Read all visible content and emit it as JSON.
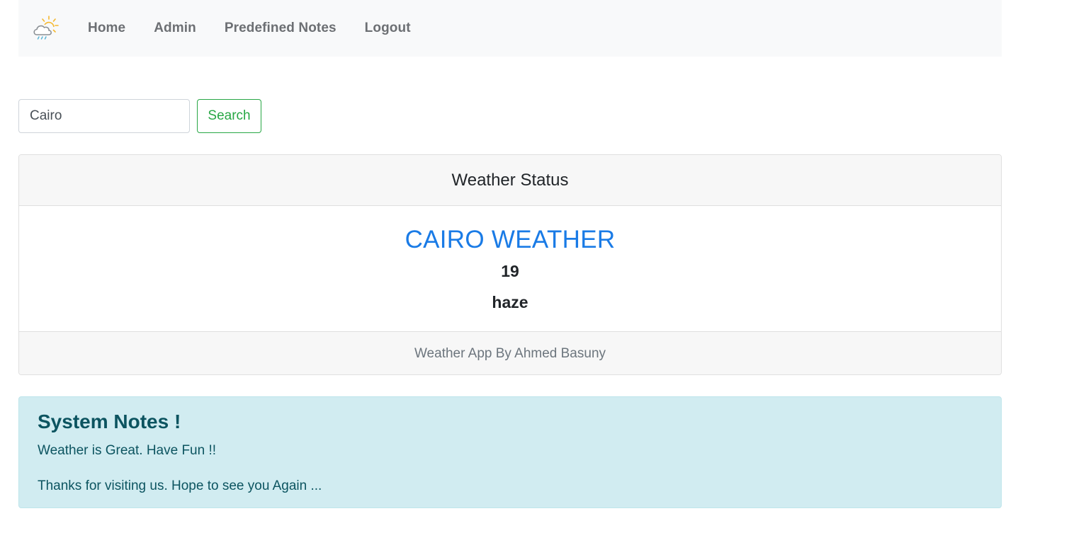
{
  "nav": {
    "brand_icon": "weather-logo-icon",
    "links": [
      {
        "label": "Home"
      },
      {
        "label": "Admin"
      },
      {
        "label": "Predefined Notes"
      },
      {
        "label": "Logout"
      }
    ]
  },
  "search": {
    "value": "Cairo",
    "button_label": "Search"
  },
  "weather_card": {
    "header": "Weather Status",
    "city_title": "CAIRO WEATHER",
    "temperature": "19",
    "description": "haze",
    "footer": "Weather App By Ahmed Basuny"
  },
  "notes": {
    "heading": "System Notes !",
    "lines": [
      "Weather is Great. Have Fun !!",
      "Thanks for visiting us. Hope to see you Again ..."
    ]
  },
  "colors": {
    "accent_blue": "#1a7be6",
    "success_green": "#28a745",
    "info_bg": "#d1ecf1",
    "info_text": "#0c5460"
  }
}
